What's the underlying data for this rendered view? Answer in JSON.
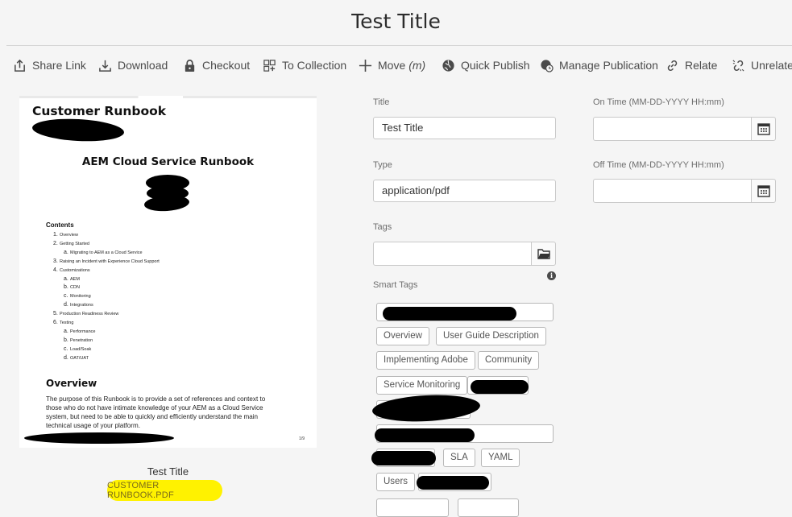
{
  "header": {
    "title": "Test Title"
  },
  "toolbar": {
    "share": "Share Link",
    "download": "Download",
    "checkout": "Checkout",
    "collection": "To Collection",
    "move": "Move",
    "move_shortcut": "(m)",
    "quick_publish": "Quick Publish",
    "manage_publication": "Manage Publication",
    "relate": "Relate",
    "unrelate": "Unrelate"
  },
  "preview": {
    "heading": "Customer Runbook",
    "subheading": "AEM Cloud Service Runbook",
    "contents_title": "Contents",
    "toc": [
      {
        "n": "1.",
        "text": "Overview"
      },
      {
        "n": "2.",
        "text": "Getting Started"
      },
      {
        "n": "a.",
        "text": "Migrating to AEM as a Cloud Service"
      },
      {
        "n": "3.",
        "text": "Raising an Incident with Experience Cloud Support"
      },
      {
        "n": "4.",
        "text": "Customizations"
      },
      {
        "n": "a.",
        "text": "AEM"
      },
      {
        "n": "b.",
        "text": "CDN"
      },
      {
        "n": "c.",
        "text": "Monitoring"
      },
      {
        "n": "d.",
        "text": "Integrations"
      },
      {
        "n": "5.",
        "text": "Production Readiness Review"
      },
      {
        "n": "6.",
        "text": "Testing"
      },
      {
        "n": "a.",
        "text": "Performance"
      },
      {
        "n": "b.",
        "text": "Penetration"
      },
      {
        "n": "c.",
        "text": "Load/Soak"
      },
      {
        "n": "d.",
        "text": "OAT/UAT"
      }
    ],
    "overview_heading": "Overview",
    "overview_text": "The purpose of this Runbook is to provide a set of references and context to those who do not have intimate knowledge of your AEM as a Cloud Service system, but need to be able to quickly and efficiently understand the main technical usage of your platform.",
    "page_number": "1/9"
  },
  "asset": {
    "title": "Test Title",
    "filename": "CUSTOMER RUNBOOK.PDF"
  },
  "form": {
    "title_label": "Title",
    "title_value": "Test Title",
    "type_label": "Type",
    "type_value": "application/pdf",
    "tags_label": "Tags",
    "tags_value": "",
    "on_time_label": "On Time (MM-DD-YYYY HH:mm)",
    "on_time_value": "",
    "off_time_label": "Off Time (MM-DD-YYYY HH:mm)",
    "off_time_value": "",
    "smart_tags_label": "Smart Tags",
    "smart_tags": [
      "Overview",
      "User Guide Description",
      "Implementing Adobe",
      "Community",
      "Service Monitoring",
      "SLA",
      "YAML",
      "Users"
    ]
  },
  "icons": [
    "share-icon",
    "download-icon",
    "lock-icon",
    "collection-icon",
    "move-icon",
    "globe-publish-icon",
    "globe-clock-icon",
    "link-icon",
    "unlink-icon",
    "calendar-icon",
    "folder-icon",
    "info-icon"
  ]
}
